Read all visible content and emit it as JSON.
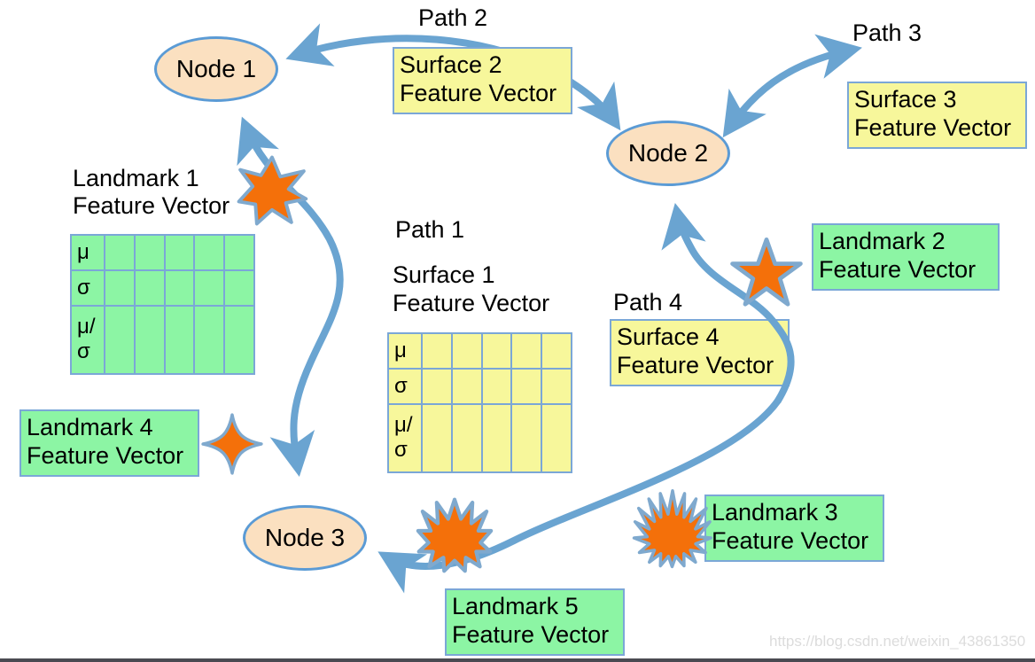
{
  "nodes": [
    {
      "id": "node1",
      "label": "Node 1"
    },
    {
      "id": "node2",
      "label": "Node 2"
    },
    {
      "id": "node3",
      "label": "Node 3"
    }
  ],
  "path_labels": {
    "path1": "Path 1",
    "path2": "Path 2",
    "path3": "Path 3",
    "path4": "Path 4"
  },
  "surfaces": {
    "surface1": {
      "title": "Surface 1",
      "subtitle": "Feature Vector"
    },
    "surface2": {
      "title": "Surface 2",
      "subtitle": "Feature Vector"
    },
    "surface3": {
      "title": "Surface 3",
      "subtitle": "Feature Vector"
    },
    "surface4": {
      "title": "Surface 4",
      "subtitle": "Feature Vector"
    }
  },
  "landmarks": {
    "landmark1": {
      "title": "Landmark 1",
      "subtitle": "Feature Vector",
      "star": "7-point-burst"
    },
    "landmark2": {
      "title": "Landmark 2",
      "subtitle": "Feature Vector",
      "star": "5-point-star"
    },
    "landmark3": {
      "title": "Landmark 3",
      "subtitle": "Feature Vector",
      "star": "16-point-burst"
    },
    "landmark4": {
      "title": "Landmark 4",
      "subtitle": "Feature Vector",
      "star": "4-point-star"
    },
    "landmark5": {
      "title": "Landmark 5",
      "subtitle": "Feature Vector",
      "star": "12-point-burst"
    }
  },
  "feature_tables": {
    "landmark1_table": {
      "columns": 6,
      "row_labels": [
        "μ",
        "σ",
        "μ/σ"
      ],
      "color": "green"
    },
    "surface1_table": {
      "columns": 6,
      "row_labels": [
        "μ",
        "σ",
        "μ/σ"
      ],
      "color": "yellow"
    }
  },
  "colors": {
    "node_fill": "#FBE0C0",
    "edge_blue": "#6AA4D1",
    "outline_blue": "#5B9BD5",
    "box_border": "#7BA7D7",
    "yellow_fill": "#F7F79B",
    "green_fill": "#8CF5A4",
    "star_orange": "#F4700A",
    "watermark_gray": "#DCDCDC"
  },
  "watermark": "https://blog.csdn.net/weixin_43861350"
}
